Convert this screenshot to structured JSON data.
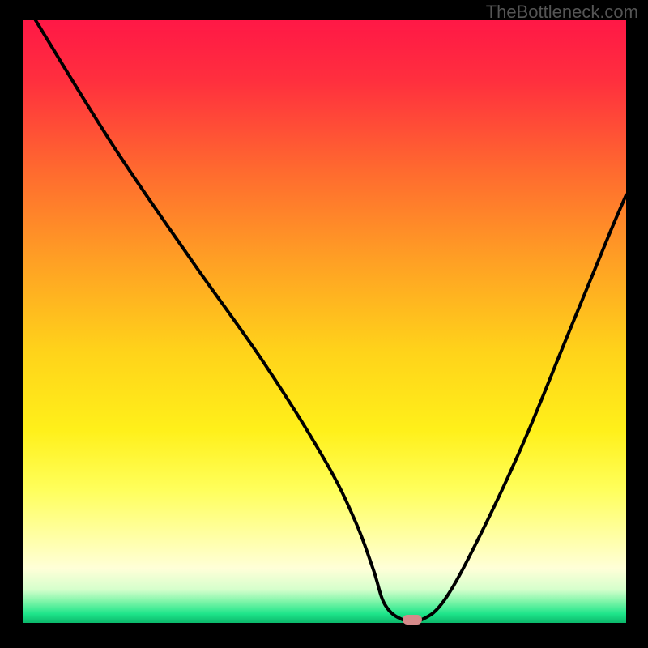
{
  "attribution": "TheBottleneck.com",
  "chart_data": {
    "type": "line",
    "title": "",
    "xlabel": "",
    "ylabel": "",
    "xlim": [
      0,
      100
    ],
    "ylim": [
      0,
      100
    ],
    "series": [
      {
        "name": "bottleneck-curve",
        "x": [
          2,
          15,
          28,
          40,
          50,
          55,
          58,
          60,
          63,
          66,
          70,
          76,
          83,
          90,
          97,
          100
        ],
        "y": [
          100,
          79,
          60,
          43,
          27,
          17,
          9,
          3,
          0.5,
          0.5,
          4,
          15,
          30,
          47,
          64,
          71
        ]
      }
    ],
    "marker": {
      "x": 64.5,
      "y": 0.5
    },
    "gradient": {
      "stops": [
        {
          "pos": 0.0,
          "color": "#ff1846"
        },
        {
          "pos": 0.1,
          "color": "#ff2f3e"
        },
        {
          "pos": 0.25,
          "color": "#ff6a2f"
        },
        {
          "pos": 0.4,
          "color": "#ffa024"
        },
        {
          "pos": 0.55,
          "color": "#ffd31a"
        },
        {
          "pos": 0.68,
          "color": "#fff01a"
        },
        {
          "pos": 0.78,
          "color": "#ffff5c"
        },
        {
          "pos": 0.86,
          "color": "#ffffa8"
        },
        {
          "pos": 0.91,
          "color": "#ffffd8"
        },
        {
          "pos": 0.945,
          "color": "#d5ffcc"
        },
        {
          "pos": 0.965,
          "color": "#7cf5a8"
        },
        {
          "pos": 0.985,
          "color": "#1ee58a"
        },
        {
          "pos": 1.0,
          "color": "#0cb86b"
        }
      ]
    }
  }
}
